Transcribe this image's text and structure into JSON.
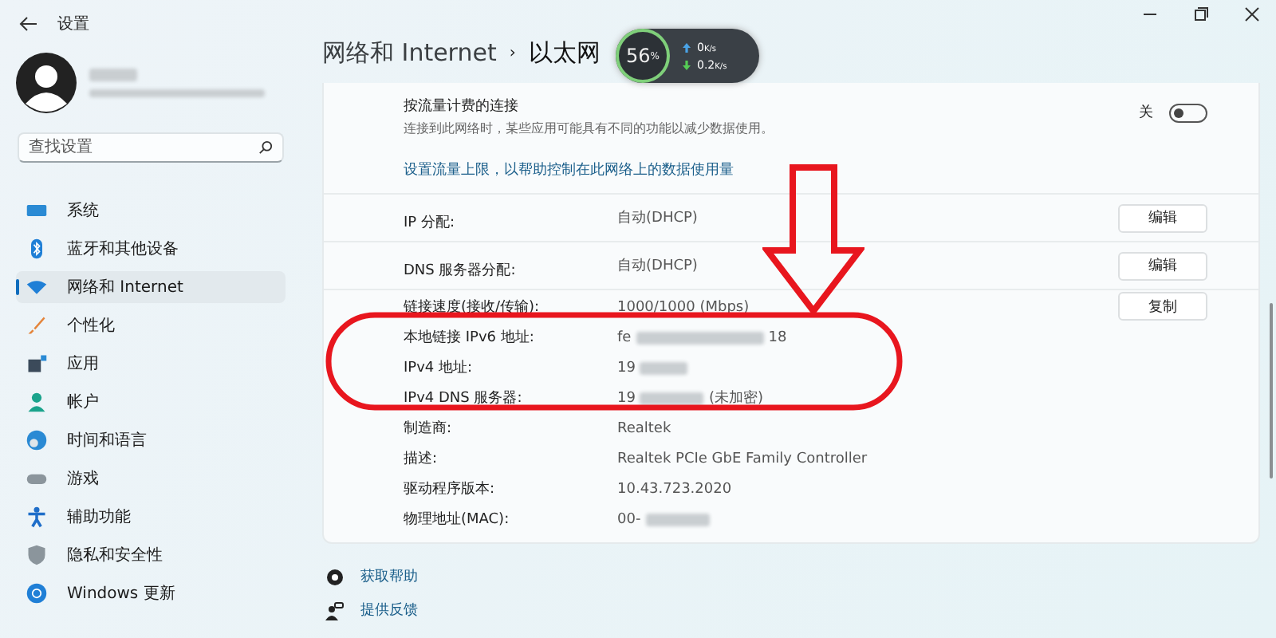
{
  "window": {
    "title": "设置"
  },
  "search": {
    "placeholder": "查找设置"
  },
  "nav": [
    {
      "label": "系统",
      "selected": false
    },
    {
      "label": "蓝牙和其他设备",
      "selected": false
    },
    {
      "label": "网络和 Internet",
      "selected": true
    },
    {
      "label": "个性化",
      "selected": false
    },
    {
      "label": "应用",
      "selected": false
    },
    {
      "label": "帐户",
      "selected": false
    },
    {
      "label": "时间和语言",
      "selected": false
    },
    {
      "label": "游戏",
      "selected": false
    },
    {
      "label": "辅助功能",
      "selected": false
    },
    {
      "label": "隐私和安全性",
      "selected": false
    },
    {
      "label": "Windows 更新",
      "selected": false
    }
  ],
  "breadcrumb": {
    "parent": "网络和 Internet",
    "separator": "›",
    "current": "以太网"
  },
  "net_widget": {
    "cpu": "56",
    "unit": "%",
    "upload": "0",
    "upload_unit": "K/s",
    "download": "0.2",
    "download_unit": "K/s"
  },
  "metered": {
    "title": "按流量计费的连接",
    "description": "连接到此网络时，某些应用可能具有不同的功能以减少数据使用。",
    "state_label": "关",
    "on": false
  },
  "data_limit_link": "设置流量上限，以帮助控制在此网络上的数据使用量",
  "assignments": [
    {
      "label": "IP 分配:",
      "value": "自动(DHCP)",
      "button": "编辑"
    },
    {
      "label": "DNS 服务器分配:",
      "value": "自动(DHCP)",
      "button": "编辑"
    }
  ],
  "copy_button": "复制",
  "properties": [
    {
      "label": "链接速度(接收/传输):",
      "value": "1000/1000 (Mbps)"
    },
    {
      "label": "本地链接 IPv6 地址:",
      "value": "fe",
      "redacted": true,
      "value_end": "18"
    },
    {
      "label": "IPv4 地址:",
      "value": "19",
      "redacted": true
    },
    {
      "label": "IPv4 DNS 服务器:",
      "value": "19",
      "redacted": true,
      "value_end": "(未加密)"
    },
    {
      "label": "制造商:",
      "value": "Realtek"
    },
    {
      "label": "描述:",
      "value": "Realtek PCIe GbE Family Controller"
    },
    {
      "label": "驱动程序版本:",
      "value": "10.43.723.2020"
    },
    {
      "label": "物理地址(MAC):",
      "value": "00-",
      "redacted": true
    }
  ],
  "footer_links": [
    "获取帮助",
    "提供反馈"
  ]
}
